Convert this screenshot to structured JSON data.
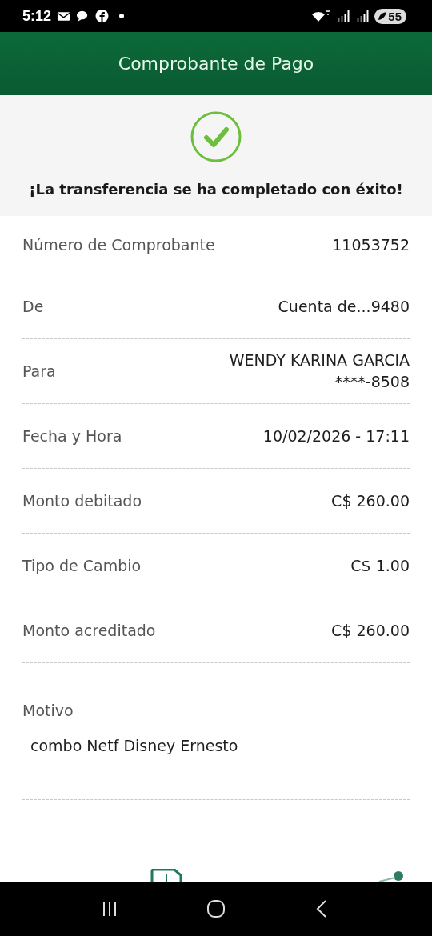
{
  "status_bar": {
    "time": "5:12",
    "battery": "55"
  },
  "header": {
    "title": "Comprobante de Pago"
  },
  "result": {
    "kind": "success",
    "message": "¡La transferencia se ha completado con éxito!"
  },
  "details": [
    {
      "label": "Número de Comprobante",
      "value": [
        "11053752"
      ]
    },
    {
      "label": "De",
      "value": [
        "Cuenta de...9480"
      ]
    },
    {
      "label": "Para",
      "value": [
        "WENDY KARINA GARCIA",
        "****-8508"
      ]
    },
    {
      "label": "Fecha y Hora",
      "value": [
        "10/02/2026 - 17:11"
      ]
    },
    {
      "label": "Monto debitado",
      "value": [
        "C$ 260.00"
      ]
    },
    {
      "label": "Tipo de Cambio",
      "value": [
        "C$ 1.00"
      ]
    },
    {
      "label": "Monto acreditado",
      "value": [
        "C$ 260.00"
      ]
    }
  ],
  "motivo": {
    "label": "Motivo",
    "value": "combo Netf Disney Ernesto"
  }
}
